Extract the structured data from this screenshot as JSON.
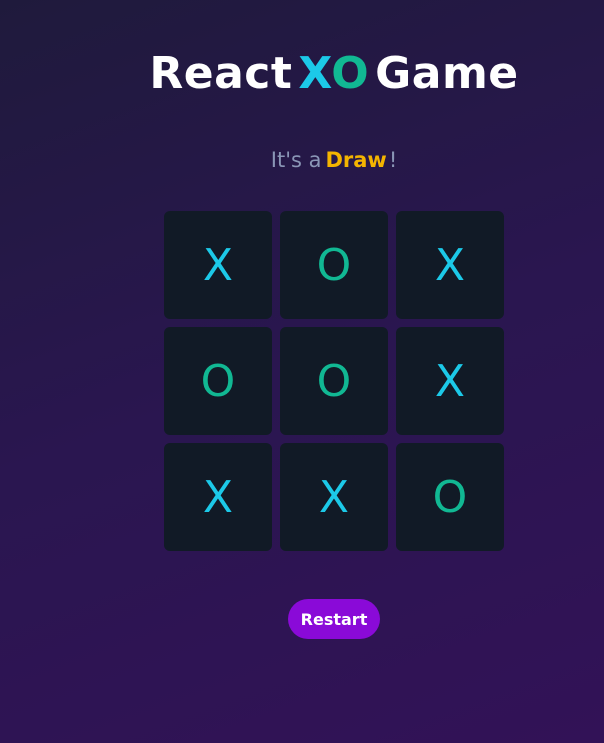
{
  "header": {
    "title_prefix": "React",
    "logo_x": "X",
    "logo_o": "O",
    "title_suffix": "Game"
  },
  "status": {
    "prefix": "It's a",
    "result": "Draw",
    "suffix": "!"
  },
  "board": {
    "cells": [
      "X",
      "O",
      "X",
      "O",
      "O",
      "X",
      "X",
      "X",
      "O"
    ]
  },
  "controls": {
    "restart_label": "Restart"
  },
  "colors": {
    "x_mark": "#1cc9e8",
    "o_mark": "#11b893",
    "result_highlight": "#f4b400",
    "button": "#8a0ad8",
    "cell_background": "#111a26"
  }
}
